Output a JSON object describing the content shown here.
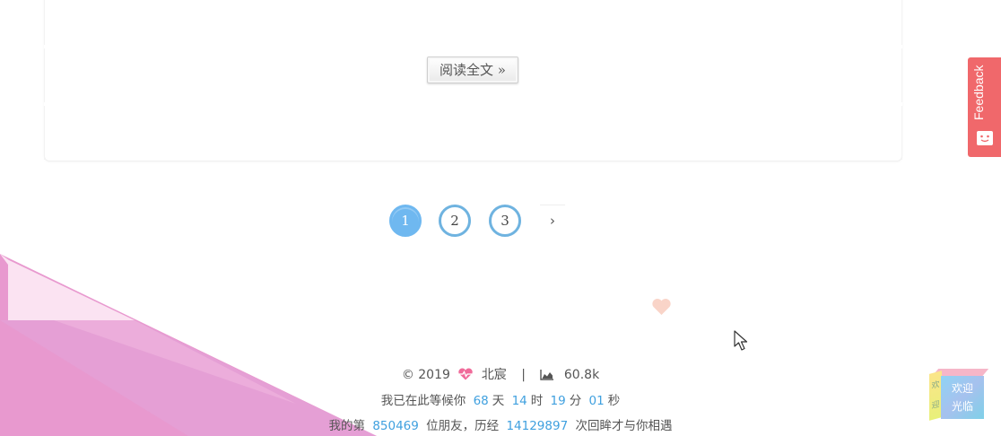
{
  "post": {
    "read_more_label": "阅读全文 »"
  },
  "pagination": {
    "pages": [
      "1",
      "2",
      "3"
    ],
    "active_page": "1",
    "next_label": "›"
  },
  "feedback": {
    "label": "Feedback"
  },
  "footer": {
    "copyright": "© 2019",
    "author": "北宸",
    "divider": "|",
    "word_count": "60.8k",
    "waiting_prefix": "我已在此等候你",
    "days": "68",
    "days_unit": "天",
    "hours": "14",
    "hours_unit": "时",
    "minutes": "19",
    "minutes_unit": "分",
    "seconds": "01",
    "seconds_unit": "秒",
    "visitor_prefix": "我的第",
    "visitor_count": "850469",
    "visitor_mid": "位朋友，历经",
    "view_count": "14129897",
    "visitor_suffix": "次回眸才与你相遇"
  },
  "cube": {
    "front_line1": "欢迎",
    "front_line2": "光临",
    "side_text": "欢迎"
  },
  "colors": {
    "accent": "#3fa0df",
    "pagination_active": "#6fb8f0",
    "pagination_border": "#6fb3e0",
    "feedback_bg": "#f0686b",
    "heart": "#f9d4c8",
    "footer_heart": "#f06b9a"
  },
  "icons": {
    "heart": "heart-pulse-icon",
    "chart": "area-chart-icon",
    "feedback": "feedback-face-icon",
    "cursor": "mouse-cursor-icon"
  }
}
